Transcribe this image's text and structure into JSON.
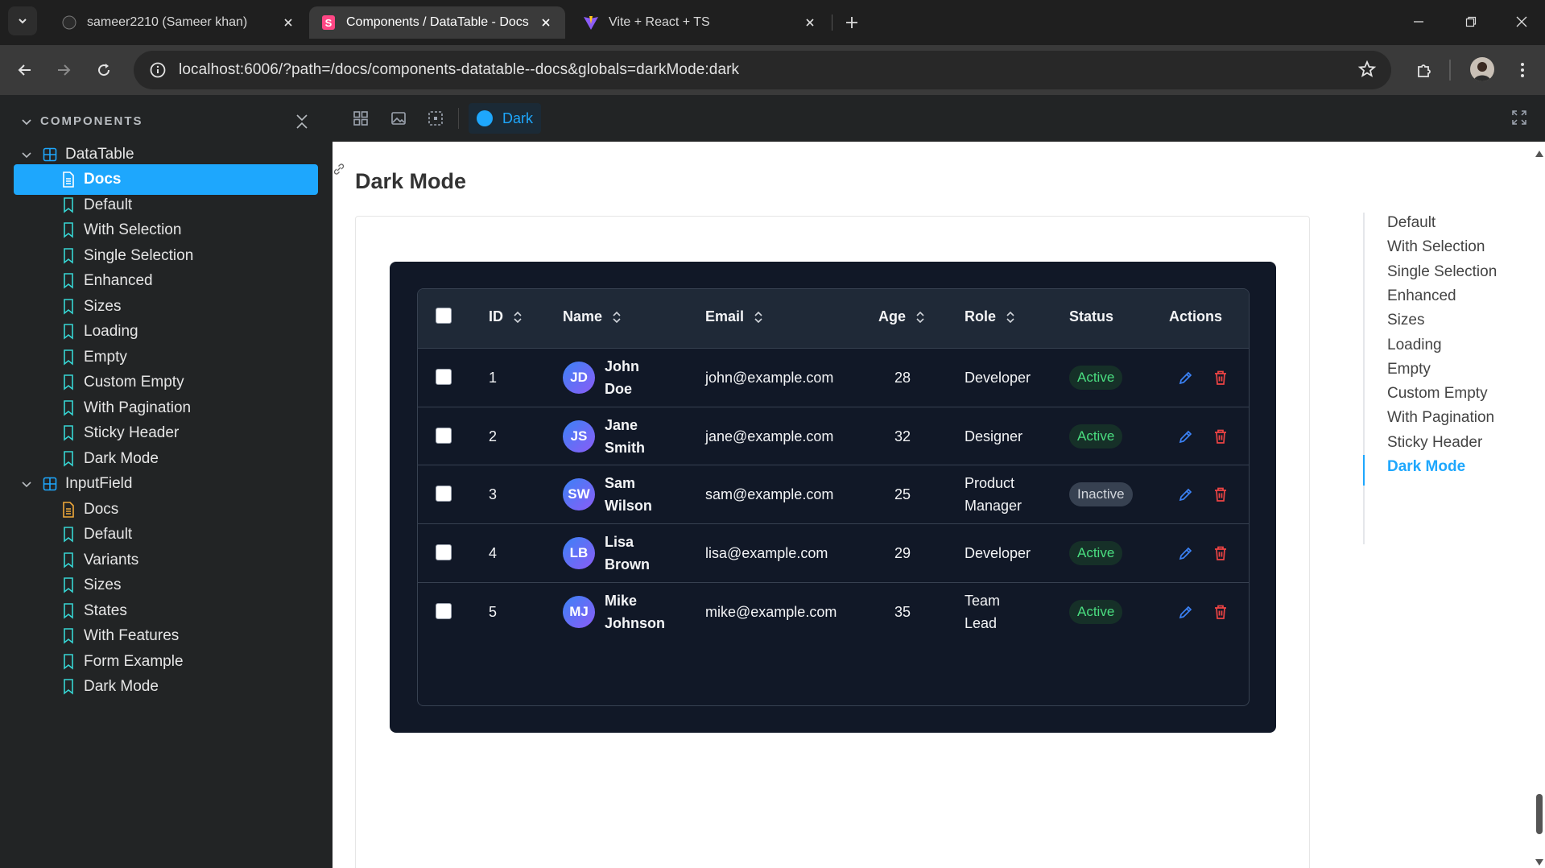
{
  "browser": {
    "tabs": [
      {
        "title": "sameer2210 (Sameer khan)",
        "active": false
      },
      {
        "title": "Components / DataTable - Docs",
        "active": true
      },
      {
        "title": "Vite + React + TS",
        "active": false
      }
    ],
    "url": "localhost:6006/?path=/docs/components-datatable--docs&globals=darkMode:dark"
  },
  "sidebar": {
    "section_title": "COMPONENTS",
    "groups": [
      {
        "label": "DataTable",
        "items": [
          "Docs",
          "Default",
          "With Selection",
          "Single Selection",
          "Enhanced",
          "Sizes",
          "Loading",
          "Empty",
          "Custom Empty",
          "With Pagination",
          "Sticky Header",
          "Dark Mode"
        ]
      },
      {
        "label": "InputField",
        "items": [
          "Docs",
          "Default",
          "Variants",
          "Sizes",
          "States",
          "With Features",
          "Form Example",
          "Dark Mode"
        ]
      }
    ]
  },
  "toolbar": {
    "theme_toggle_label": "Dark",
    "accent": "#1ea7fd"
  },
  "docs": {
    "title": "Dark Mode",
    "table": {
      "columns": [
        "ID",
        "Name",
        "Email",
        "Age",
        "Role",
        "Status",
        "Actions"
      ],
      "rows": [
        {
          "id": "1",
          "initials": "JD",
          "first": "John",
          "last": "Doe",
          "email": "john@example.com",
          "age": "28",
          "role1": "Developer",
          "role2": "",
          "status": "Active"
        },
        {
          "id": "2",
          "initials": "JS",
          "first": "Jane",
          "last": "Smith",
          "email": "jane@example.com",
          "age": "32",
          "role1": "Designer",
          "role2": "",
          "status": "Active"
        },
        {
          "id": "3",
          "initials": "SW",
          "first": "Sam",
          "last": "Wilson",
          "email": "sam@example.com",
          "age": "25",
          "role1": "Product",
          "role2": "Manager",
          "status": "Inactive"
        },
        {
          "id": "4",
          "initials": "LB",
          "first": "Lisa",
          "last": "Brown",
          "email": "lisa@example.com",
          "age": "29",
          "role1": "Developer",
          "role2": "",
          "status": "Active"
        },
        {
          "id": "5",
          "initials": "MJ",
          "first": "Mike",
          "last": "Johnson",
          "email": "mike@example.com",
          "age": "35",
          "role1": "Team",
          "role2": "Lead",
          "status": "Active"
        }
      ]
    },
    "toc": [
      "Default",
      "With Selection",
      "Single Selection",
      "Enhanced",
      "Sizes",
      "Loading",
      "Empty",
      "Custom Empty",
      "With Pagination",
      "Sticky Header",
      "Dark Mode"
    ],
    "toc_current": "Dark Mode"
  }
}
